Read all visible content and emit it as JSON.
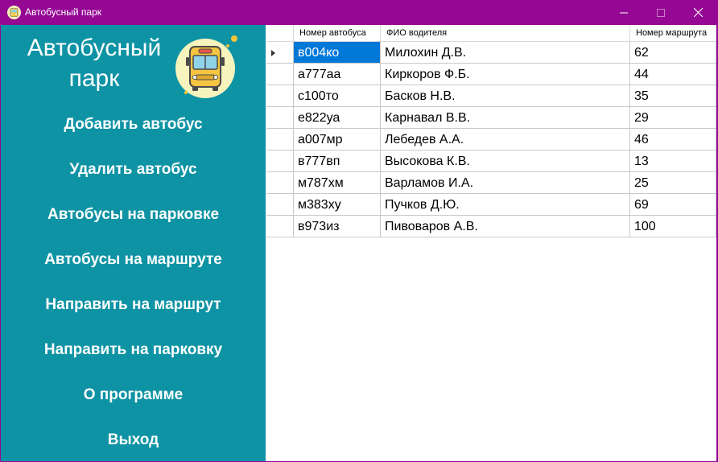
{
  "window": {
    "title": "Автобусный парк",
    "colors": {
      "titlebar": "#940894",
      "sidebar": "#0e93a4",
      "selection": "#0078d7"
    },
    "controls": {
      "minimize": "minimize-icon",
      "maximize": "maximize-icon",
      "close": "close-icon"
    }
  },
  "sidebar": {
    "brand_line1": "Автобусный",
    "brand_line2": "парк",
    "brand_icon": "bus-icon",
    "menu": [
      {
        "label": "Добавить автобус"
      },
      {
        "label": "Удалить автобус"
      },
      {
        "label": "Автобусы на парковке"
      },
      {
        "label": "Автобусы на маршруте"
      },
      {
        "label": "Направить на маршрут"
      },
      {
        "label": "Направить на парковку"
      },
      {
        "label": "О программе"
      },
      {
        "label": "Выход"
      }
    ]
  },
  "grid": {
    "columns": [
      "Номер автобуса",
      "ФИО водителя",
      "Номер маршрута"
    ],
    "current_row": 0,
    "selected_cell": {
      "row": 0,
      "column": 0
    },
    "rows": [
      [
        "в004ко",
        "Милохин Д.В.",
        "62"
      ],
      [
        "а777аа",
        "Киркоров Ф.Б.",
        "44"
      ],
      [
        "с100то",
        "Басков Н.В.",
        "35"
      ],
      [
        "е822уа",
        "Карнавал В.В.",
        "29"
      ],
      [
        "а007мр",
        "Лебедев А.А.",
        "46"
      ],
      [
        "в777вп",
        "Высокова К.В.",
        "13"
      ],
      [
        "м787хм",
        "Варламов И.А.",
        "25"
      ],
      [
        "м383ху",
        "Пучков Д.Ю.",
        "69"
      ],
      [
        "в973из",
        "Пивоваров А.В.",
        "100"
      ]
    ]
  }
}
